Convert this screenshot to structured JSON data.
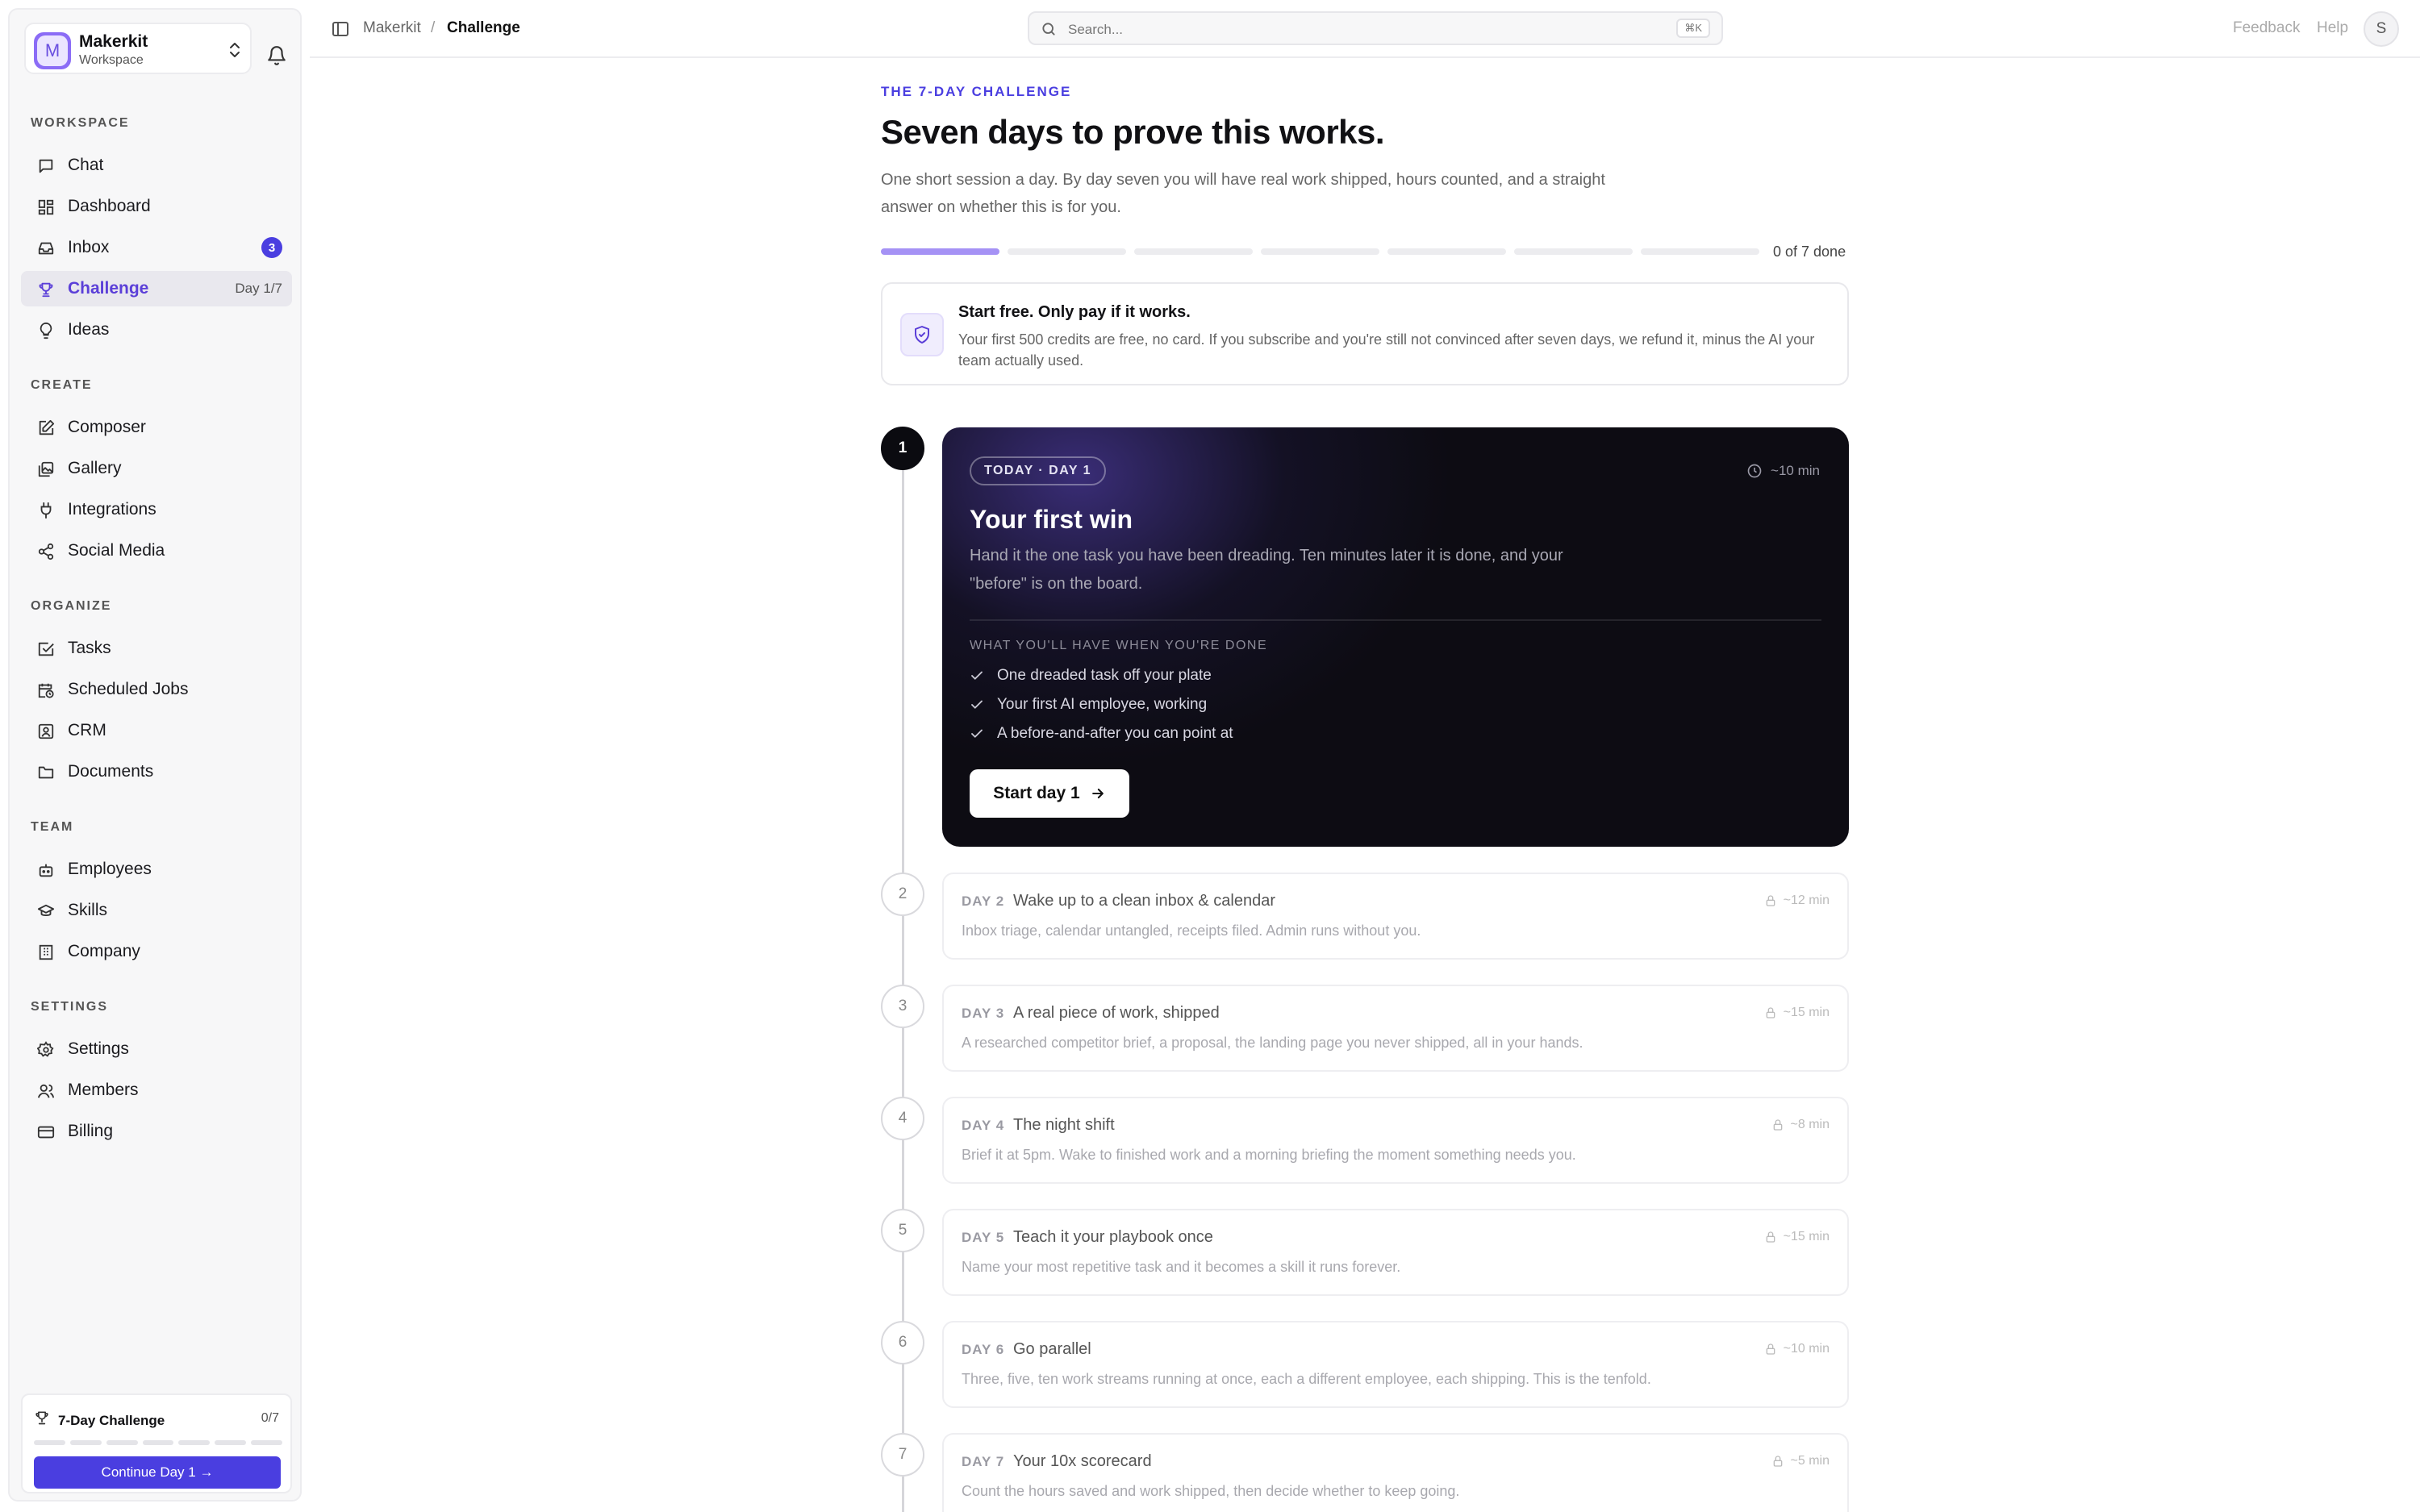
{
  "workspace": {
    "name": "Makerkit",
    "sub": "Workspace",
    "initial": "M"
  },
  "sidebar": {
    "sections": [
      {
        "label": "WORKSPACE",
        "items": [
          {
            "id": "chat",
            "label": "Chat",
            "icon": "chat-icon"
          },
          {
            "id": "dashboard",
            "label": "Dashboard",
            "icon": "dashboard-icon"
          },
          {
            "id": "inbox",
            "label": "Inbox",
            "icon": "inbox-icon",
            "badge": "3"
          },
          {
            "id": "challenge",
            "label": "Challenge",
            "icon": "trophy-icon",
            "meta": "Day 1/7",
            "active": true
          },
          {
            "id": "ideas",
            "label": "Ideas",
            "icon": "lightbulb-icon"
          }
        ]
      },
      {
        "label": "CREATE",
        "items": [
          {
            "id": "composer",
            "label": "Composer",
            "icon": "edit-icon"
          },
          {
            "id": "gallery",
            "label": "Gallery",
            "icon": "gallery-icon"
          },
          {
            "id": "integrations",
            "label": "Integrations",
            "icon": "plug-icon"
          },
          {
            "id": "social-media",
            "label": "Social Media",
            "icon": "share-icon"
          }
        ]
      },
      {
        "label": "ORGANIZE",
        "items": [
          {
            "id": "tasks",
            "label": "Tasks",
            "icon": "checkbox-icon"
          },
          {
            "id": "scheduled-jobs",
            "label": "Scheduled Jobs",
            "icon": "calendar-clock-icon"
          },
          {
            "id": "crm",
            "label": "CRM",
            "icon": "contact-icon"
          },
          {
            "id": "documents",
            "label": "Documents",
            "icon": "folder-icon"
          }
        ]
      },
      {
        "label": "TEAM",
        "items": [
          {
            "id": "employees",
            "label": "Employees",
            "icon": "bot-icon"
          },
          {
            "id": "skills",
            "label": "Skills",
            "icon": "graduation-cap-icon"
          },
          {
            "id": "company",
            "label": "Company",
            "icon": "building-icon"
          }
        ]
      },
      {
        "label": "SETTINGS",
        "items": [
          {
            "id": "settings",
            "label": "Settings",
            "icon": "gear-icon"
          },
          {
            "id": "members",
            "label": "Members",
            "icon": "users-icon"
          },
          {
            "id": "billing",
            "label": "Billing",
            "icon": "credit-card-icon"
          }
        ]
      }
    ],
    "challenge_widget": {
      "title": "7-Day Challenge",
      "count": "0/7",
      "progress": 0,
      "button": "Continue Day 1 →"
    }
  },
  "topbar": {
    "crumbs": [
      "Makerkit",
      "Challenge"
    ],
    "crumb_sep": "/",
    "search_placeholder": "Search...",
    "search_kbd": "⌘K",
    "feedback": "Feedback",
    "help": "Help",
    "avatar": "S"
  },
  "main": {
    "eyebrow": "THE 7-DAY CHALLENGE",
    "title": "Seven days to prove this works.",
    "subtitle": "One short session a day. By day seven you will have real work shipped, hours counted, and a straight answer on whether this is for you.",
    "progress": {
      "segments": 7,
      "current": 1,
      "done": 0,
      "label": "0 of 7 done"
    },
    "guarantee": {
      "title": "Start free. Only pay if it works.",
      "text": "Your first 500 credits are free, no card. If you subscribe and you're still not convinced after seven days, we refund it, minus the AI your team actually used."
    },
    "today": {
      "number": "1",
      "pill": "TODAY · DAY 1",
      "time": "~10 min",
      "title": "Your first win",
      "desc": "Hand it the one task you have been dreading. Ten minutes later it is done, and your \"before\" is on the board.",
      "outcomes_label": "WHAT YOU'LL HAVE WHEN YOU'RE DONE",
      "outcomes": [
        "One dreaded task off your plate",
        "Your first AI employee, working",
        "A before-and-after you can point at"
      ],
      "button": "Start day 1"
    },
    "days": [
      {
        "number": "2",
        "label": "DAY 2",
        "title": "Wake up to a clean inbox & calendar",
        "time": "~12 min",
        "desc": "Inbox triage, calendar untangled, receipts filed. Admin runs without you."
      },
      {
        "number": "3",
        "label": "DAY 3",
        "title": "A real piece of work, shipped",
        "time": "~15 min",
        "desc": "A researched competitor brief, a proposal, the landing page you never shipped, all in your hands."
      },
      {
        "number": "4",
        "label": "DAY 4",
        "title": "The night shift",
        "time": "~8 min",
        "desc": "Brief it at 5pm. Wake to finished work and a morning briefing the moment something needs you."
      },
      {
        "number": "5",
        "label": "DAY 5",
        "title": "Teach it your playbook once",
        "time": "~15 min",
        "desc": "Name your most repetitive task and it becomes a skill it runs forever."
      },
      {
        "number": "6",
        "label": "DAY 6",
        "title": "Go parallel",
        "time": "~10 min",
        "desc": "Three, five, ten work streams running at once, each a different employee, each shipping. This is the tenfold."
      },
      {
        "number": "7",
        "label": "DAY 7",
        "title": "Your 10x scorecard",
        "time": "~5 min",
        "desc": "Count the hours saved and work shipped, then decide whether to keep going."
      }
    ]
  }
}
